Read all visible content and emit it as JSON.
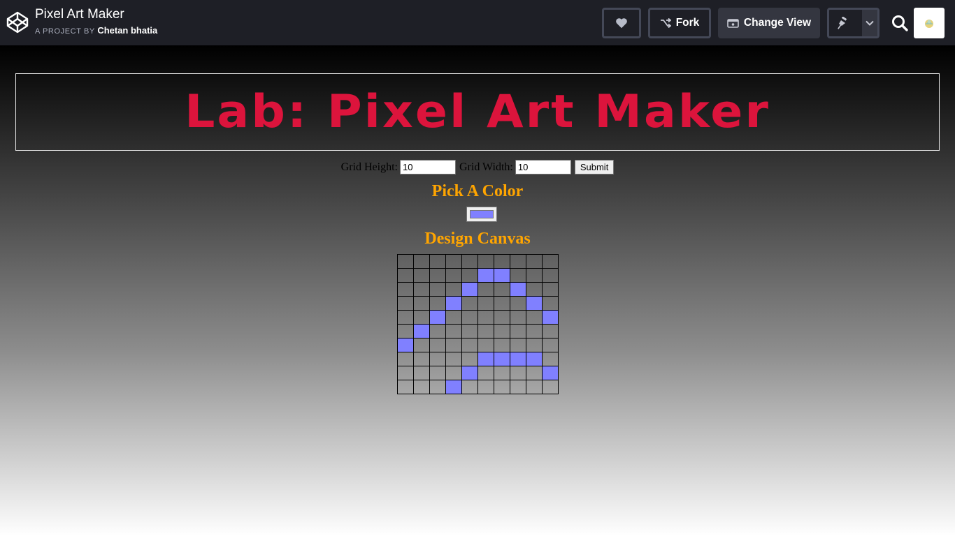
{
  "topbar": {
    "project_title": "Pixel Art Maker",
    "project_by_label": "A PROJECT BY",
    "author": "Chetan bhatia",
    "fork_label": "Fork",
    "change_view_label": "Change View"
  },
  "preview": {
    "heading": "Lab: Pixel Art Maker",
    "grid_height_label": "Grid Height:",
    "grid_height_value": "10",
    "grid_width_label": "Grid Width:",
    "grid_width_value": "10",
    "submit_label": "Submit",
    "pick_color_title": "Pick A Color",
    "selected_color": "#8080ff",
    "design_canvas_title": "Design Canvas",
    "grid_rows": 10,
    "grid_cols": 10,
    "painted_cells": [
      [
        1,
        5
      ],
      [
        1,
        6
      ],
      [
        2,
        4
      ],
      [
        2,
        7
      ],
      [
        3,
        3
      ],
      [
        3,
        8
      ],
      [
        4,
        2
      ],
      [
        4,
        9
      ],
      [
        5,
        1
      ],
      [
        6,
        0
      ],
      [
        7,
        5
      ],
      [
        7,
        6
      ],
      [
        7,
        7
      ],
      [
        7,
        8
      ],
      [
        8,
        4
      ],
      [
        8,
        9
      ],
      [
        9,
        3
      ]
    ]
  },
  "colors": {
    "topbar_bg": "#1e1f26",
    "heading_color": "#dc143c",
    "title_color": "#ffa500",
    "paint_color": "#8080ff"
  }
}
